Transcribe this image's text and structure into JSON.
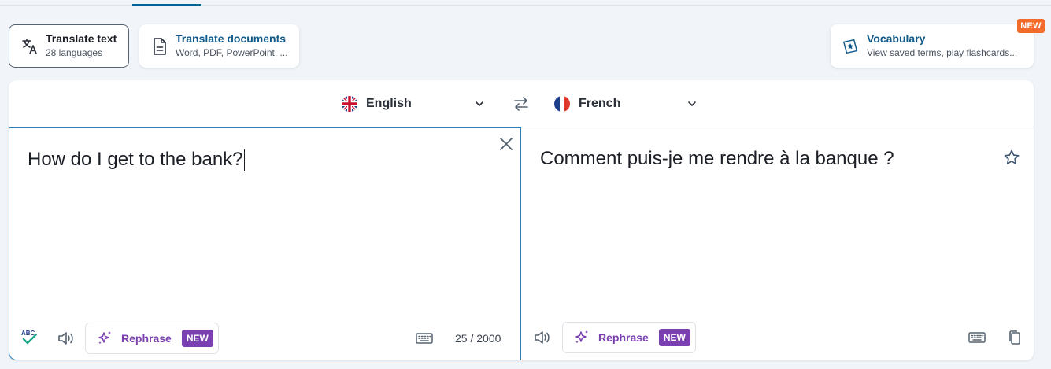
{
  "tabs": [
    {
      "title": "Translate text",
      "subtitle": "28 languages"
    },
    {
      "title": "Translate documents",
      "subtitle": "Word, PDF, PowerPoint, ..."
    },
    {
      "title": "Vocabulary",
      "subtitle": "View saved terms, play flashcards..."
    }
  ],
  "vocabulary_badge": "NEW",
  "source_language": "English",
  "target_language": "French",
  "source": {
    "text": "How do I get to the bank?",
    "char_count": "25 / 2000"
  },
  "target": {
    "text": "Comment puis-je me rendre à la banque ?"
  },
  "rephrase": {
    "label": "Rephrase",
    "badge": "NEW"
  },
  "spellcheck_icon_text": "ABC",
  "colors": {
    "accent": "#006494",
    "new_badge": "#f26b2a",
    "rephrase": "#7a3fb0",
    "source_border": "#2f7db4"
  }
}
